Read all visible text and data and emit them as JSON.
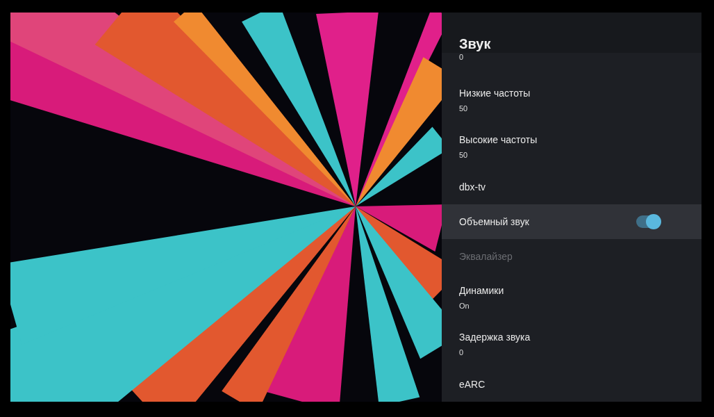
{
  "panel": {
    "title": "Звук"
  },
  "items": [
    {
      "kind": "value-tail",
      "value": "0"
    },
    {
      "kind": "setting",
      "title": "Низкие частоты",
      "value": "50",
      "focused": false,
      "disabled": false
    },
    {
      "kind": "setting",
      "title": "Высокие частоты",
      "value": "50",
      "focused": false,
      "disabled": false
    },
    {
      "kind": "plain",
      "title": "dbx-tv",
      "focused": false,
      "disabled": false
    },
    {
      "kind": "toggle",
      "title": "Объемный звук",
      "on": true,
      "focused": true,
      "disabled": false
    },
    {
      "kind": "plain",
      "title": "Эквалайзер",
      "focused": false,
      "disabled": true
    },
    {
      "kind": "setting",
      "title": "Динамики",
      "value": "On",
      "focused": false,
      "disabled": false
    },
    {
      "kind": "setting",
      "title": "Задержка звука",
      "value": "0",
      "focused": false,
      "disabled": false
    },
    {
      "kind": "plain",
      "title": "eARC",
      "focused": false,
      "disabled": false
    }
  ]
}
